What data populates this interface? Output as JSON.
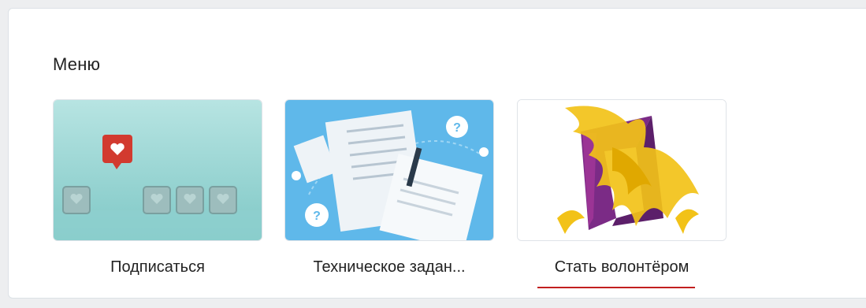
{
  "menu": {
    "title": "Меню",
    "items": [
      {
        "label": "Подписаться",
        "icon": "subscribe-heart-icon"
      },
      {
        "label": "Техническое задан...",
        "icon": "documents-question-icon"
      },
      {
        "label": "Стать волонтёром",
        "icon": "phoenix-logo-icon"
      }
    ]
  },
  "colors": {
    "accent_underline": "#c21f1f",
    "panel_bg": "#ffffff",
    "page_bg": "#edeef0"
  }
}
